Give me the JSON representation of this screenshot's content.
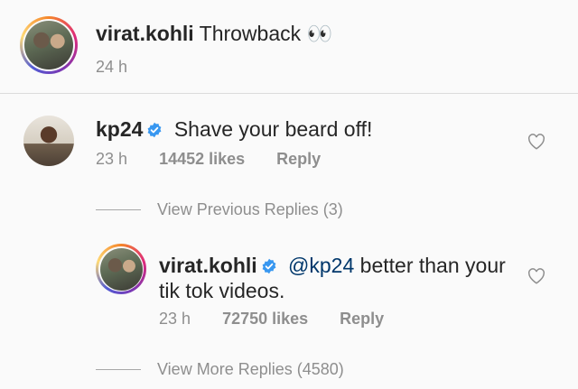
{
  "caption": {
    "username": "virat.kohli",
    "text": "Throwback 👀",
    "time": "24 h"
  },
  "comment": {
    "username": "kp24",
    "text": "Shave your beard off!",
    "time": "23 h",
    "likes": "14452 likes",
    "reply_label": "Reply"
  },
  "view_previous": "View Previous Replies (3)",
  "reply": {
    "username": "virat.kohli",
    "mention": "@kp24",
    "text_line1": " better than your",
    "text_line2": "tik tok videos.",
    "time": "23 h",
    "likes": "72750 likes",
    "reply_label": "Reply"
  },
  "view_more": "View More Replies (4580)",
  "colors": {
    "verified": "#3897f0",
    "mention": "#00376b",
    "meta": "#8e8e8e"
  },
  "icons": {
    "verified": "verified-badge-icon",
    "like": "heart-outline-icon"
  }
}
